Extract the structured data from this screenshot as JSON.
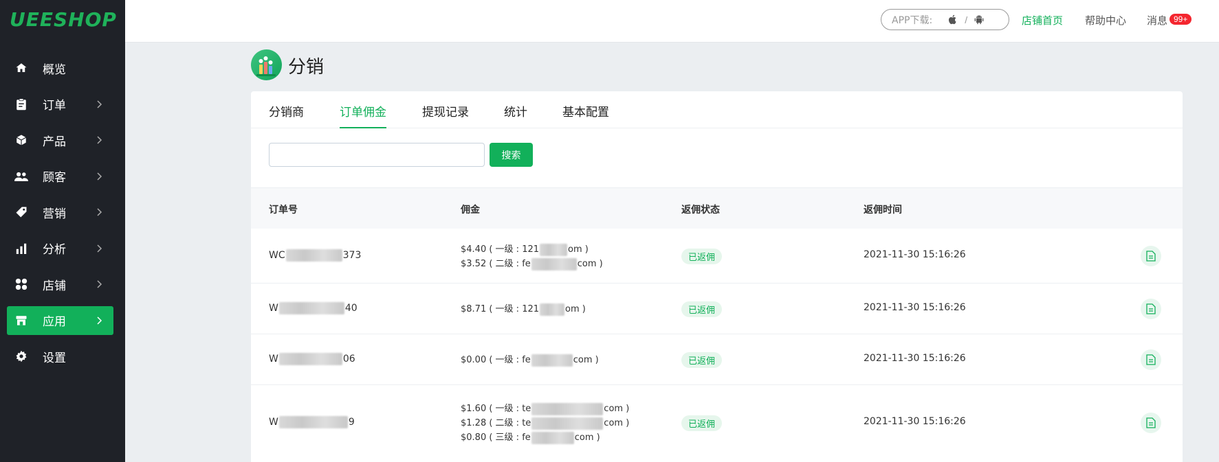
{
  "brand": {
    "logo": "UEESHOP",
    "accent": "#12b05a"
  },
  "sidebar": {
    "items": [
      {
        "label": "概览",
        "icon": "home-icon",
        "has_chevron": false,
        "active": false
      },
      {
        "label": "订单",
        "icon": "clipboard-icon",
        "has_chevron": true,
        "active": false
      },
      {
        "label": "产品",
        "icon": "box-icon",
        "has_chevron": true,
        "active": false
      },
      {
        "label": "顾客",
        "icon": "users-icon",
        "has_chevron": true,
        "active": false
      },
      {
        "label": "营销",
        "icon": "tag-icon",
        "has_chevron": true,
        "active": false
      },
      {
        "label": "分析",
        "icon": "bar-chart-icon",
        "has_chevron": true,
        "active": false
      },
      {
        "label": "店铺",
        "icon": "grid-icon",
        "has_chevron": true,
        "active": false
      },
      {
        "label": "应用",
        "icon": "store-icon",
        "has_chevron": true,
        "active": true
      },
      {
        "label": "设置",
        "icon": "gear-icon",
        "has_chevron": false,
        "active": false
      }
    ]
  },
  "topbar": {
    "app_download": "APP下载:",
    "separator": "/",
    "store_home": "店铺首页",
    "help_center": "帮助中心",
    "messages": "消息",
    "messages_badge": "99+"
  },
  "page": {
    "title": "分销"
  },
  "tabs": [
    {
      "label": "分销商",
      "active": false
    },
    {
      "label": "订单佣金",
      "active": true
    },
    {
      "label": "提现记录",
      "active": false
    },
    {
      "label": "统计",
      "active": false
    },
    {
      "label": "基本配置",
      "active": false
    }
  ],
  "search": {
    "value": "",
    "placeholder": "",
    "button": "搜索"
  },
  "table": {
    "headers": [
      "订单号",
      "佣金",
      "返佣状态",
      "返佣时间"
    ],
    "rows": [
      {
        "order_prefix": "WC",
        "order_suffix": "373",
        "commissions": [
          {
            "text_a": "$4.40 ( 一级 : 121",
            "text_b": "om )"
          },
          {
            "text_a": "$3.52 ( 二级 : fe",
            "text_b": "com )"
          }
        ],
        "status": "已返佣",
        "time": "2021-11-30 15:16:26"
      },
      {
        "order_prefix": "W",
        "order_suffix": "40",
        "commissions": [
          {
            "text_a": "$8.71 ( 一级 : 121",
            "text_b": "om )"
          }
        ],
        "status": "已返佣",
        "time": "2021-11-30 15:16:26"
      },
      {
        "order_prefix": "W",
        "order_suffix": "06",
        "commissions": [
          {
            "text_a": "$0.00 ( 一级 : fe",
            "text_b": "com )"
          }
        ],
        "status": "已返佣",
        "time": "2021-11-30 15:16:26"
      },
      {
        "order_prefix": "W",
        "order_suffix": "9",
        "commissions": [
          {
            "text_a": "$1.60 ( 一级 : te",
            "text_b": "com )"
          },
          {
            "text_a": "$1.28 ( 二级 : te",
            "text_b": "com )"
          },
          {
            "text_a": "$0.80 ( 三级 : fe",
            "text_b": "com )"
          }
        ],
        "status": "已返佣",
        "time": "2021-11-30 15:16:26"
      }
    ]
  }
}
